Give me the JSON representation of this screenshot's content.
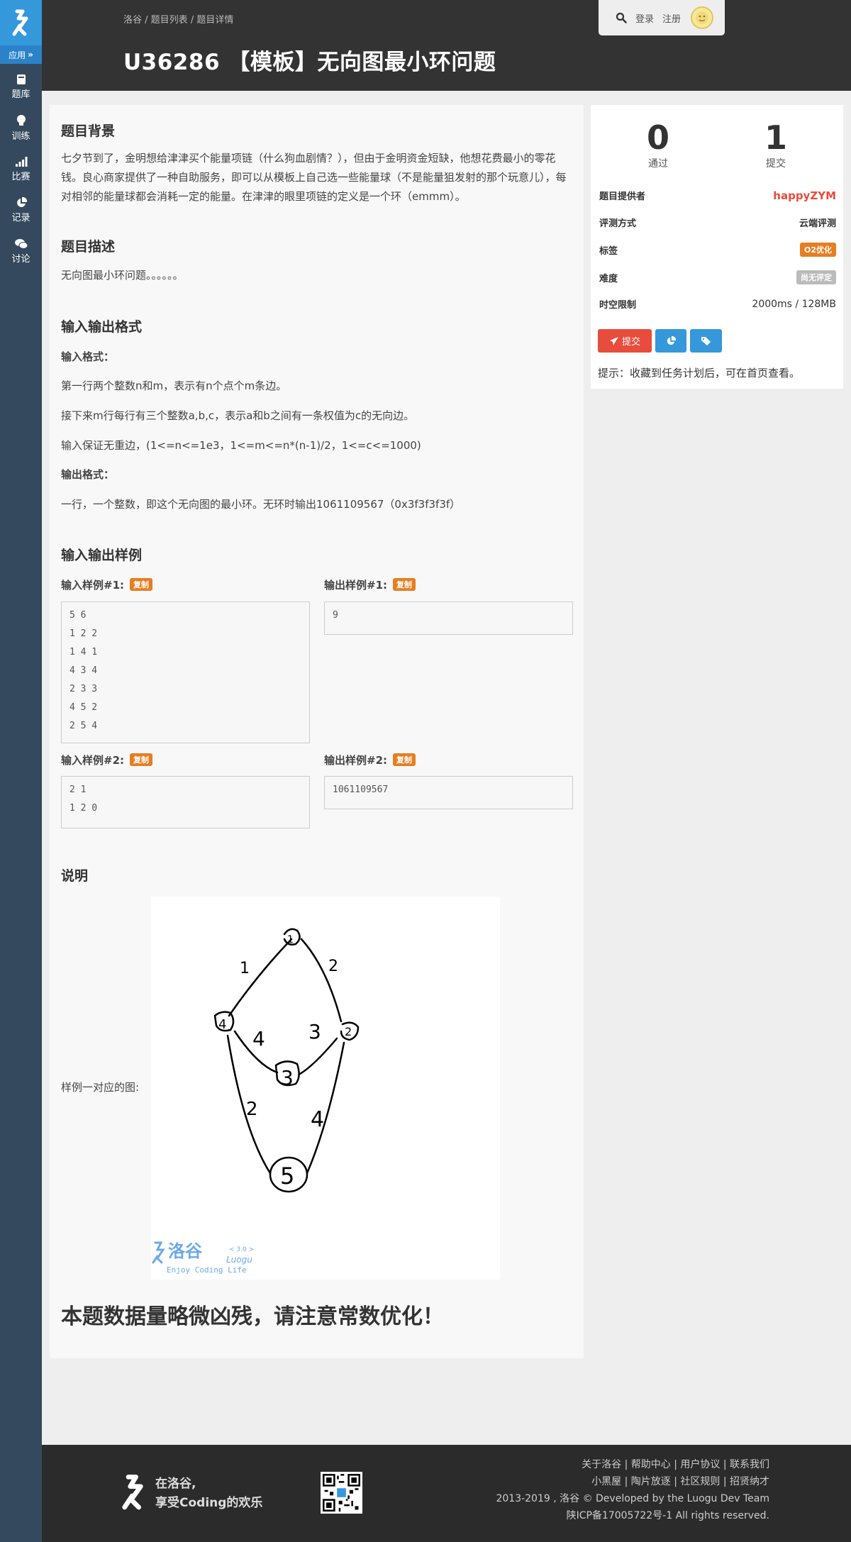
{
  "sidebar": {
    "apps_label": "应用",
    "items": [
      {
        "label": "题库",
        "icon": "book-icon"
      },
      {
        "label": "训练",
        "icon": "lightbulb-icon"
      },
      {
        "label": "比赛",
        "icon": "signal-bars-icon"
      },
      {
        "label": "记录",
        "icon": "pie-chart-icon"
      },
      {
        "label": "讨论",
        "icon": "comments-icon"
      }
    ]
  },
  "header": {
    "breadcrumb": [
      "洛谷",
      "题目列表",
      "题目详情"
    ],
    "title": "U36286 【模板】无向图最小环问题",
    "login": "登录",
    "register": "注册"
  },
  "problem": {
    "background_title": "题目背景",
    "background_text": "七夕节到了，金明想给津津买个能量项链（什么狗血剧情？），但由于金明资金短缺，他想花费最小的零花钱。良心商家提供了一种自助服务，即可以从模板上自己选一些能量球（不是能量狙发射的那个玩意儿），每对相邻的能量球都会消耗一定的能量。在津津的眼里项链的定义是一个环（emmm）。",
    "description_title": "题目描述",
    "description_text": "无向图最小环问题。。。。。。",
    "io_title": "输入输出格式",
    "input_format_label": "输入格式：",
    "input_lines": [
      "第一行两个整数n和m，表示有n个点个m条边。",
      "接下来m行每行有三个整数a,b,c，表示a和b之间有一条权值为c的无向边。",
      "输入保证无重边，(1<=n<=1e3，1<=m<=n*(n-1)/2，1<=c<=1000)"
    ],
    "output_format_label": "输出格式：",
    "output_text": "一行，一个整数，即这个无向图的最小环。无环时输出1061109567（0x3f3f3f3f）",
    "samples_title": "输入输出样例",
    "copy_label": "复制",
    "samples": [
      {
        "input_label": "输入样例#1:",
        "input": "5 6\n1 2 2\n1 4 1\n4 3 4\n2 3 3\n4 5 2\n2 5 4",
        "output_label": "输出样例#1:",
        "output": "9"
      },
      {
        "input_label": "输入样例#2:",
        "input": "2 1\n1 2 0",
        "output_label": "输出样例#2:",
        "output": "1061109567"
      }
    ],
    "notes_title": "说明",
    "figure_caption": "样例一对应的图:",
    "figure_nodes": [
      "1",
      "2",
      "3",
      "4",
      "5"
    ],
    "figure_weights": [
      "1",
      "2",
      "3",
      "4",
      "2",
      "4"
    ],
    "watermark_text": "洛谷",
    "watermark_version": "< 3.0 >",
    "watermark_latin": "Luogu",
    "watermark_slogan": "Enjoy Coding Life",
    "warning": "本题数据量略微凶残，请注意常数优化！"
  },
  "side": {
    "passed_count": "0",
    "passed_label": "通过",
    "submit_count": "1",
    "submit_label": "提交",
    "provider_label": "题目提供者",
    "provider": "happyZYM",
    "judge_label": "评测方式",
    "judge": "云端评测",
    "tags_label": "标签",
    "tag": "O2优化",
    "difficulty_label": "难度",
    "difficulty": "尚无评定",
    "limit_label": "时空限制",
    "limit": "2000ms / 128MB",
    "submit_button": "提交",
    "hint": "提示：收藏到任务计划后，可在首页查看。",
    "colors": {
      "provider": "#e74c3c",
      "tag": "#e67e22",
      "difficulty": "#bbbbbb",
      "submit_btn": "#e74c3c",
      "stat_btn": "#3498db",
      "tag_btn": "#3498db"
    }
  },
  "footer": {
    "slogan_1": "在洛谷,",
    "slogan_2": "享受Coding的欢乐",
    "links_1": "关于洛谷 | 帮助中心 | 用户协议 | 联系我们",
    "links_2": "小黑屋 | 陶片放逐 | 社区规则 | 招贤纳才",
    "copyright": "2013-2019 , 洛谷 © Developed by the Luogu Dev Team",
    "icp": "陕ICP备17005722号-1 All rights reserved."
  }
}
